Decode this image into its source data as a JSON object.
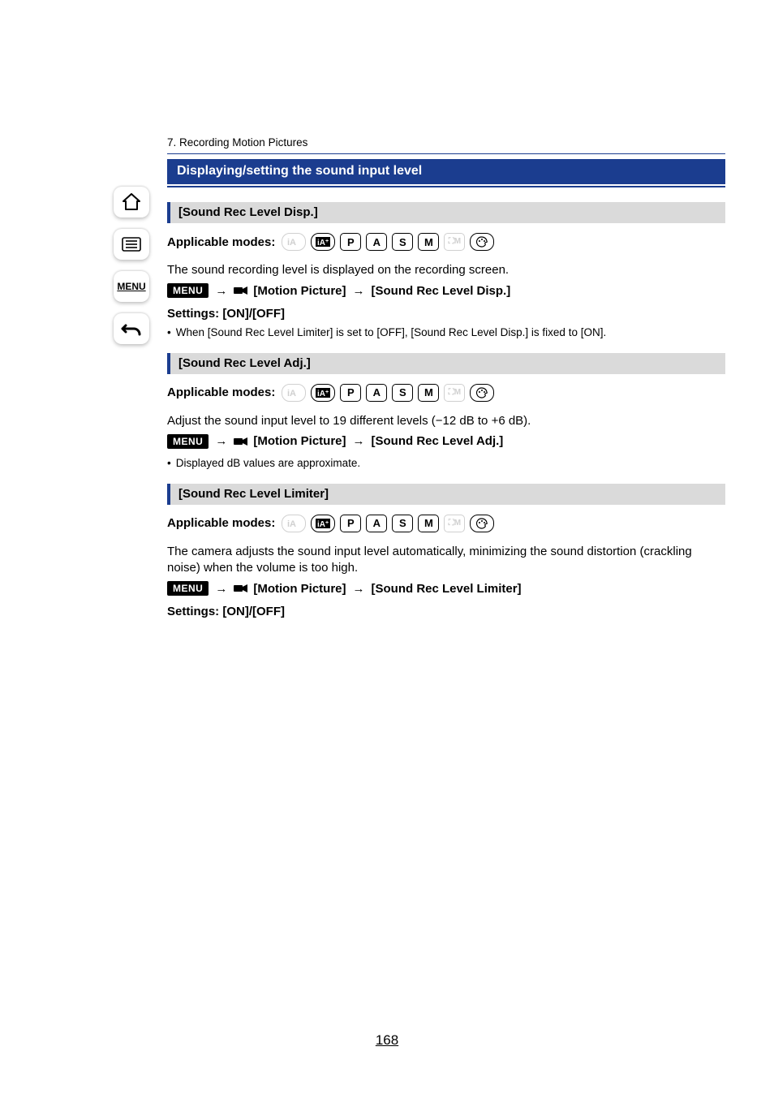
{
  "chapter": "7. Recording Motion Pictures",
  "heading": "Displaying/setting the sound input level",
  "modes_label": "Applicable modes:",
  "arrow": "→",
  "menu_chip": "MENU",
  "icon_name_mp": "motion-picture-icon",
  "mode_icons": [
    "iA",
    "iA+",
    "P",
    "A",
    "S",
    "M",
    "film-M",
    "palette"
  ],
  "sections": [
    {
      "title": "[Sound Rec Level Disp.]",
      "body": "The sound recording level is displayed on the recording screen.",
      "menu_path": [
        "[Motion Picture]",
        "[Sound Rec Level Disp.]"
      ],
      "settings": "Settings: [ON]/[OFF]",
      "note": "When [Sound Rec Level Limiter] is set to [OFF], [Sound Rec Level Disp.] is fixed to [ON]."
    },
    {
      "title": "[Sound Rec Level Adj.]",
      "body": "Adjust the sound input level to 19 different levels (−12 dB to +6 dB).",
      "menu_path": [
        "[Motion Picture]",
        "[Sound Rec Level Adj.]"
      ],
      "note": "Displayed dB values are approximate."
    },
    {
      "title": "[Sound Rec Level Limiter]",
      "body": "The camera adjusts the sound input level automatically, minimizing the sound distortion (crackling noise) when the volume is too high.",
      "menu_path": [
        "[Motion Picture]",
        "[Sound Rec Level Limiter]"
      ],
      "settings": "Settings: [ON]/[OFF]"
    }
  ],
  "sidebar": {
    "menu_label": "MENU"
  },
  "page_number": "168"
}
